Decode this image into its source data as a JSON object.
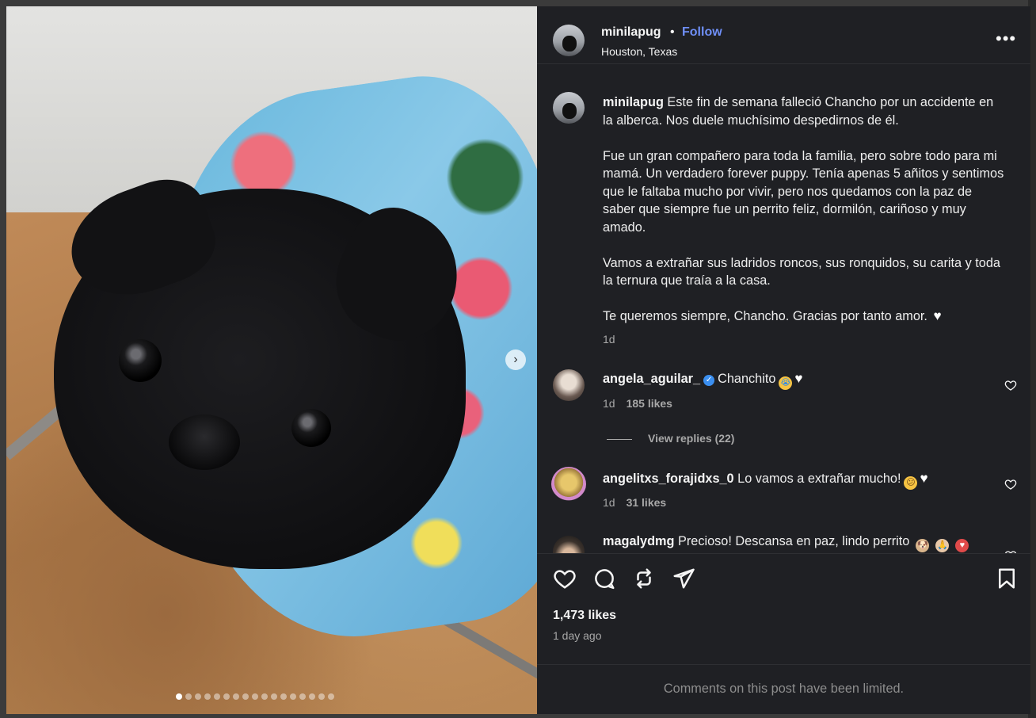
{
  "post": {
    "username": "minilapug",
    "follow_label": "Follow",
    "separator": "•",
    "location": "Houston, Texas",
    "more_label": "•••",
    "next_label": "›",
    "caption_paragraphs": [
      "Este fin de semana falleció Chancho por un accidente en la alberca. Nos duele muchísimo despedirnos de él.",
      "Fue un gran compañero para toda la familia, pero sobre todo para mi mamá. Un verdadero forever puppy. Tenía apenas 5 añitos y sentimos que le faltaba mucho por vivir, pero nos quedamos con la paz de saber que siempre fue un perrito feliz, dormilón, cariñoso y muy amado.",
      "Vamos a extrañar sus ladridos roncos, sus ronquidos, su carita y toda la ternura que traía a la casa.",
      "Te queremos siempre, Chancho. Gracias por tanto amor."
    ],
    "caption_time": "1d",
    "likes": "1,473 likes",
    "posted": "1 day ago",
    "comments_limited": "Comments on this post have been limited.",
    "carousel_count": 17,
    "carousel_active": 0
  },
  "comments": [
    {
      "username": "angela_aguilar_",
      "verified": true,
      "text": "Chanchito",
      "time": "1d",
      "likes": "185 likes"
    },
    {
      "username": "angelitxs_forajidxs_0",
      "verified": false,
      "text": "Lo vamos a extrañar mucho!",
      "time": "1d",
      "likes": "31 likes"
    },
    {
      "username": "magalydmg",
      "verified": false,
      "text": "Precioso! Descansa en paz, lindo perrito"
    }
  ],
  "replies_label": "View replies (22)",
  "colors": {
    "panel_bg": "#1f2024",
    "follow_blue": "#6f8ff7",
    "muted_text": "#a8a8a8",
    "verified_blue": "#3b8ff0"
  },
  "icons": {
    "like": "heart-icon",
    "comment": "comment-icon",
    "share": "repost-icon",
    "send": "send-icon",
    "save": "bookmark-icon",
    "more": "more-options-icon"
  }
}
